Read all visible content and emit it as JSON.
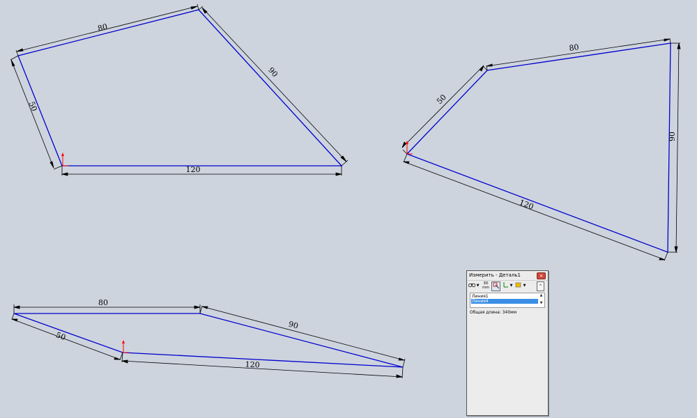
{
  "sketches": [
    {
      "name": "sketch-top-left",
      "dimensions": {
        "top": "80",
        "right": "90",
        "left": "50",
        "bottom": "120"
      }
    },
    {
      "name": "sketch-top-right",
      "dimensions": {
        "top": "80",
        "right": "90",
        "left": "50",
        "bottom": "120"
      }
    },
    {
      "name": "sketch-bottom",
      "dimensions": {
        "top": "80",
        "right": "90",
        "left": "50",
        "bottom": "120"
      }
    }
  ],
  "colors": {
    "background": "#cdd4de",
    "sketch_line": "#0000cc",
    "dimension_line": "#000000",
    "origin_axis": "#ff0000"
  },
  "measure_dialog": {
    "title": "Измерить - Деталь1",
    "close_label": "×",
    "toolbar_icons": [
      "binoculars-icon",
      "units-icon",
      "selection-icon",
      "xyz-axis-icon",
      "material-icon",
      "collapse-icon"
    ],
    "units_label": "mm",
    "list_items": [
      "Линия1",
      "Линия4"
    ],
    "selected_index": 1,
    "result_text": "Общая длина: 340мм"
  }
}
